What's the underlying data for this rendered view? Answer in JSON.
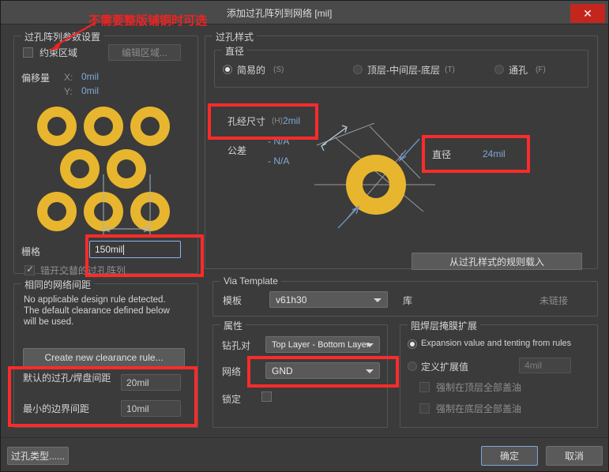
{
  "window": {
    "title": "添加过孔阵列到网络 [mil]",
    "close_label": "✕"
  },
  "annotations": {
    "top_note": "不需要整版铺铜时可选",
    "accent_color": "#fc2b2b"
  },
  "via_array_params": {
    "group_title": "过孔阵列参数设置",
    "constraint_area_label": "约束区域",
    "constraint_area_checked": false,
    "edit_area_button": "编辑区域...",
    "offset_label": "偏移量",
    "offset_x_label": "X:",
    "offset_x_value": "0mil",
    "offset_y_label": "Y:",
    "offset_y_value": "0mil",
    "grid_label": "栅格",
    "grid_value": "150mil",
    "stagger_label": "错开交替的过孔阵列",
    "stagger_checked": true
  },
  "same_net_clearance": {
    "group_title": "相同的网络间距",
    "message_line1": "No applicable design rule detected.",
    "message_line2": "The default clearance defined below",
    "message_line3": "will be used.",
    "create_rule_button": "Create new clearance rule...",
    "default_via_pad_label": "默认的过孔/焊盘间距",
    "default_via_pad_value": "20mil",
    "min_border_label": "最小的边界间距",
    "min_border_value": "10mil"
  },
  "via_style": {
    "group_title": "过孔样式",
    "diameter_group_title": "直径",
    "options": [
      {
        "label": "简易的",
        "accel": "(S)",
        "selected": true
      },
      {
        "label": "顶层-中间层-底层",
        "accel": "(T)",
        "selected": false
      },
      {
        "label": "通孔",
        "accel": "(F)",
        "selected": false
      }
    ],
    "hole_size_label": "孔经尺寸",
    "hole_size_accel": "(H)",
    "hole_size_value": "2mil",
    "tolerance_label": "公差",
    "tolerance_plus": "- N/A",
    "tolerance_minus": "- N/A",
    "diameter_label": "直径",
    "diameter_value": "24mil",
    "load_from_rules_button": "从过孔样式的规则载入"
  },
  "via_template": {
    "group_title": "Via Template",
    "template_label": "模板",
    "template_value": "v61h30",
    "library_label": "库",
    "library_value": "未链接"
  },
  "properties": {
    "group_title": "属性",
    "drill_pair_label": "钻孔对",
    "drill_pair_value": "Top Layer - Bottom Layer",
    "net_label": "网络",
    "net_value": "GND",
    "locked_label": "锁定",
    "locked_checked": false
  },
  "solder_mask": {
    "group_title": "阻焊层掩膜扩展",
    "option_rules_label": "Expansion value and tenting from rules",
    "option_rules_selected": true,
    "option_custom_label": "定义扩展值",
    "option_custom_selected": false,
    "custom_value": "4mil",
    "force_top_label": "强制在顶层全部盖油",
    "force_top_checked": false,
    "force_bottom_label": "强制在底层全部盖油",
    "force_bottom_checked": false
  },
  "footer": {
    "via_types_button": "过孔类型......",
    "ok_button": "确定",
    "cancel_button": "取消"
  }
}
